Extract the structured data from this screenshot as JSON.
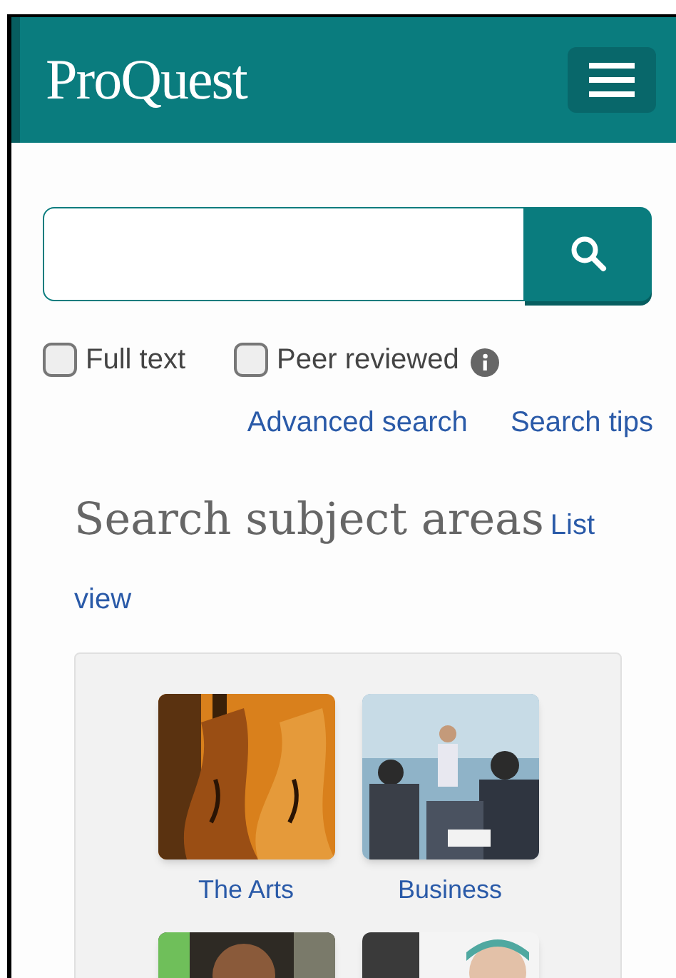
{
  "header": {
    "logo": "ProQuest"
  },
  "filters": [
    {
      "label": "Full text",
      "checked": false,
      "info": false
    },
    {
      "label": "Peer reviewed",
      "checked": false,
      "info": true
    }
  ],
  "links": [
    "Advanced search",
    "Search tips"
  ],
  "subjects": {
    "title": "Search subject areas",
    "view_link": "List view",
    "tiles": [
      {
        "kind": "tile",
        "label": "The Arts"
      },
      {
        "kind": "tile",
        "label": "Business"
      },
      {
        "kind": "cut"
      },
      {
        "kind": "cut"
      }
    ]
  }
}
